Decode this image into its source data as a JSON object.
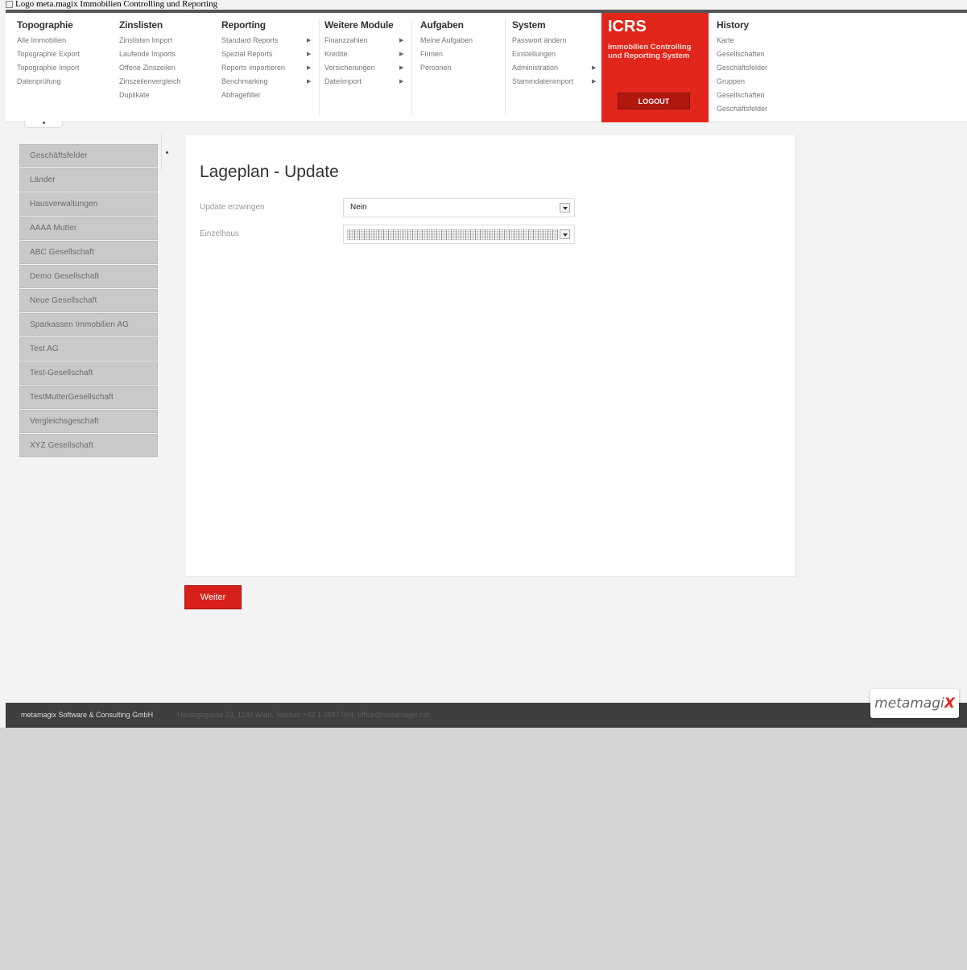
{
  "page": {
    "broken_image_alt": "Logo meta.magix Immobilien Controlling und Reporting"
  },
  "menu": [
    {
      "title": "Topographie",
      "items": [
        "Alle Immobilien",
        "Topographie Export",
        "Topographie Import",
        "Datenprüfung"
      ]
    },
    {
      "title": "Zinslisten",
      "items": [
        "Zinslisten Import",
        "Laufende Imports",
        "Offene Zinszeilen",
        "Zinszeilenvergleich",
        "Duplikate"
      ]
    },
    {
      "title": "Reporting",
      "items": [
        "Standard Reports",
        "Spezial Reports",
        "Reports importieren",
        "Benchmarking",
        "Abfragefilter"
      ]
    },
    {
      "title": "Weitere Module",
      "items": [
        "Finanzzahlen",
        "Kredite",
        "Versicherungen",
        "Dateiimport"
      ]
    },
    {
      "title": "Aufgaben",
      "items": [
        "Meine Aufgaben",
        "Firmen",
        "Personen"
      ]
    },
    {
      "title": "System",
      "items": [
        "Passwort ändern",
        "Einstellungen",
        "Administration",
        "Stammdatenimport"
      ]
    },
    {
      "title": "History",
      "items": [
        "Karte",
        "Gesellschaften",
        "Geschäftsfelder",
        "Gruppen",
        "Gesellschaften",
        "Geschäftsfelder"
      ]
    }
  ],
  "icrs": {
    "title": "ICRS",
    "subtitle_1": "Immobilien Controlling",
    "subtitle_2": "und Reporting System",
    "logout_label": "LOGOUT"
  },
  "sidebar": {
    "items": [
      "Geschäftsfelder",
      "Länder",
      "Hausverwaltungen",
      "AAAA Mutter",
      "ABC Gesellschaft",
      "Demo Gesellschaft",
      "Neue Gesellschaft",
      "Sparkassen Immobilien AG",
      "Test AG",
      "Test-Gesellschaft",
      "TestMutterGesellschaft",
      "Vergleichsgeschaft",
      "XYZ Gesellschaft"
    ]
  },
  "form": {
    "title": "Lageplan - Update",
    "field1_label": "Update erzwingen",
    "field1_value": "Nein",
    "field2_label": "Einzelhaus",
    "next_label": "Weiter"
  },
  "footer": {
    "company": "metamagix Software & Consulting GmbH",
    "address": "Herzogsgasse 23, 1180 Wien, Telefon: +43 1 3697 004, office@metamagix.net"
  },
  "logo": {
    "text": "metamagi",
    "mark": "X"
  },
  "colors": {
    "accent": "#e1261c",
    "footer": "#3f3f3f",
    "sidebar_item": "#c9c9c9"
  }
}
